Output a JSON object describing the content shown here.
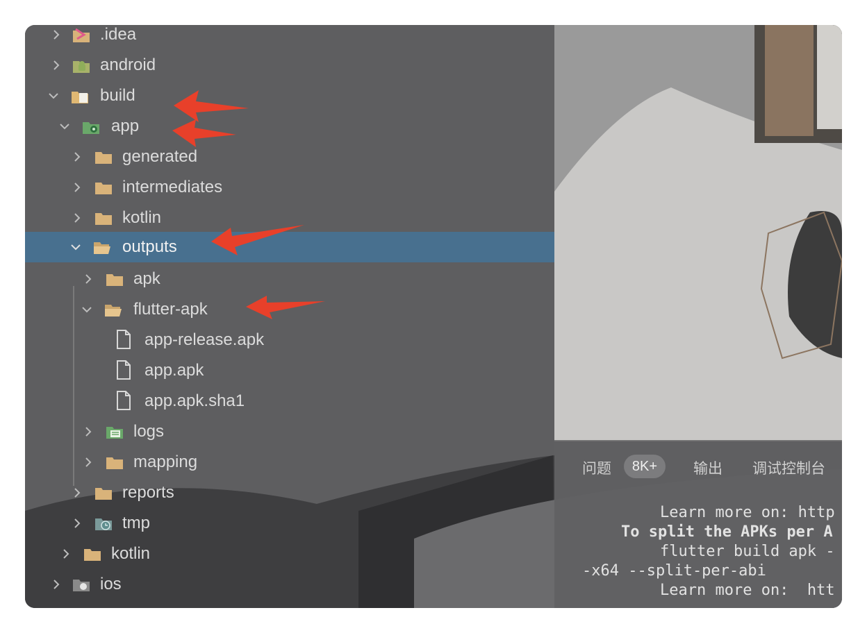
{
  "tree": {
    "items": [
      {
        "label": ".idea",
        "icon": "idea-folder-icon",
        "expanded": false
      },
      {
        "label": "android",
        "icon": "android-folder-icon",
        "expanded": false
      },
      {
        "label": "build",
        "icon": "excluded-folder-icon",
        "expanded": true
      },
      {
        "label": "app",
        "icon": "module-folder-icon",
        "expanded": true
      },
      {
        "label": "generated",
        "icon": "folder-icon",
        "expanded": false
      },
      {
        "label": "intermediates",
        "icon": "folder-icon",
        "expanded": false
      },
      {
        "label": "kotlin",
        "icon": "folder-icon",
        "expanded": false
      },
      {
        "label": "outputs",
        "icon": "folder-open-icon",
        "expanded": true,
        "selected": true
      },
      {
        "label": "apk",
        "icon": "folder-icon",
        "expanded": false
      },
      {
        "label": "flutter-apk",
        "icon": "folder-open-icon",
        "expanded": true
      },
      {
        "label": "app-release.apk",
        "icon": "file-icon"
      },
      {
        "label": "app.apk",
        "icon": "file-icon"
      },
      {
        "label": "app.apk.sha1",
        "icon": "file-icon"
      },
      {
        "label": "logs",
        "icon": "logs-folder-icon",
        "expanded": false
      },
      {
        "label": "mapping",
        "icon": "folder-icon",
        "expanded": false
      },
      {
        "label": "reports",
        "icon": "folder-icon",
        "expanded": false
      },
      {
        "label": "tmp",
        "icon": "tmp-folder-icon",
        "expanded": false
      },
      {
        "label": "kotlin",
        "icon": "folder-icon",
        "expanded": false
      },
      {
        "label": "ios",
        "icon": "ios-folder-icon",
        "expanded": false
      }
    ]
  },
  "panel": {
    "tabs": {
      "problems": "问题",
      "problems_badge": "8K+",
      "output": "输出",
      "debug_console": "调试控制台"
    },
    "terminal": {
      "lines": [
        "Learn more on: http",
        "To split the APKs per A",
        "flutter build apk -",
        "-x64 --split-per-abi",
        "Learn more on:  htt"
      ]
    }
  },
  "colors": {
    "selection": "#48708f",
    "folder": "#d9b37a",
    "arrow": "#e8402a",
    "background": "#5b5b5d"
  }
}
